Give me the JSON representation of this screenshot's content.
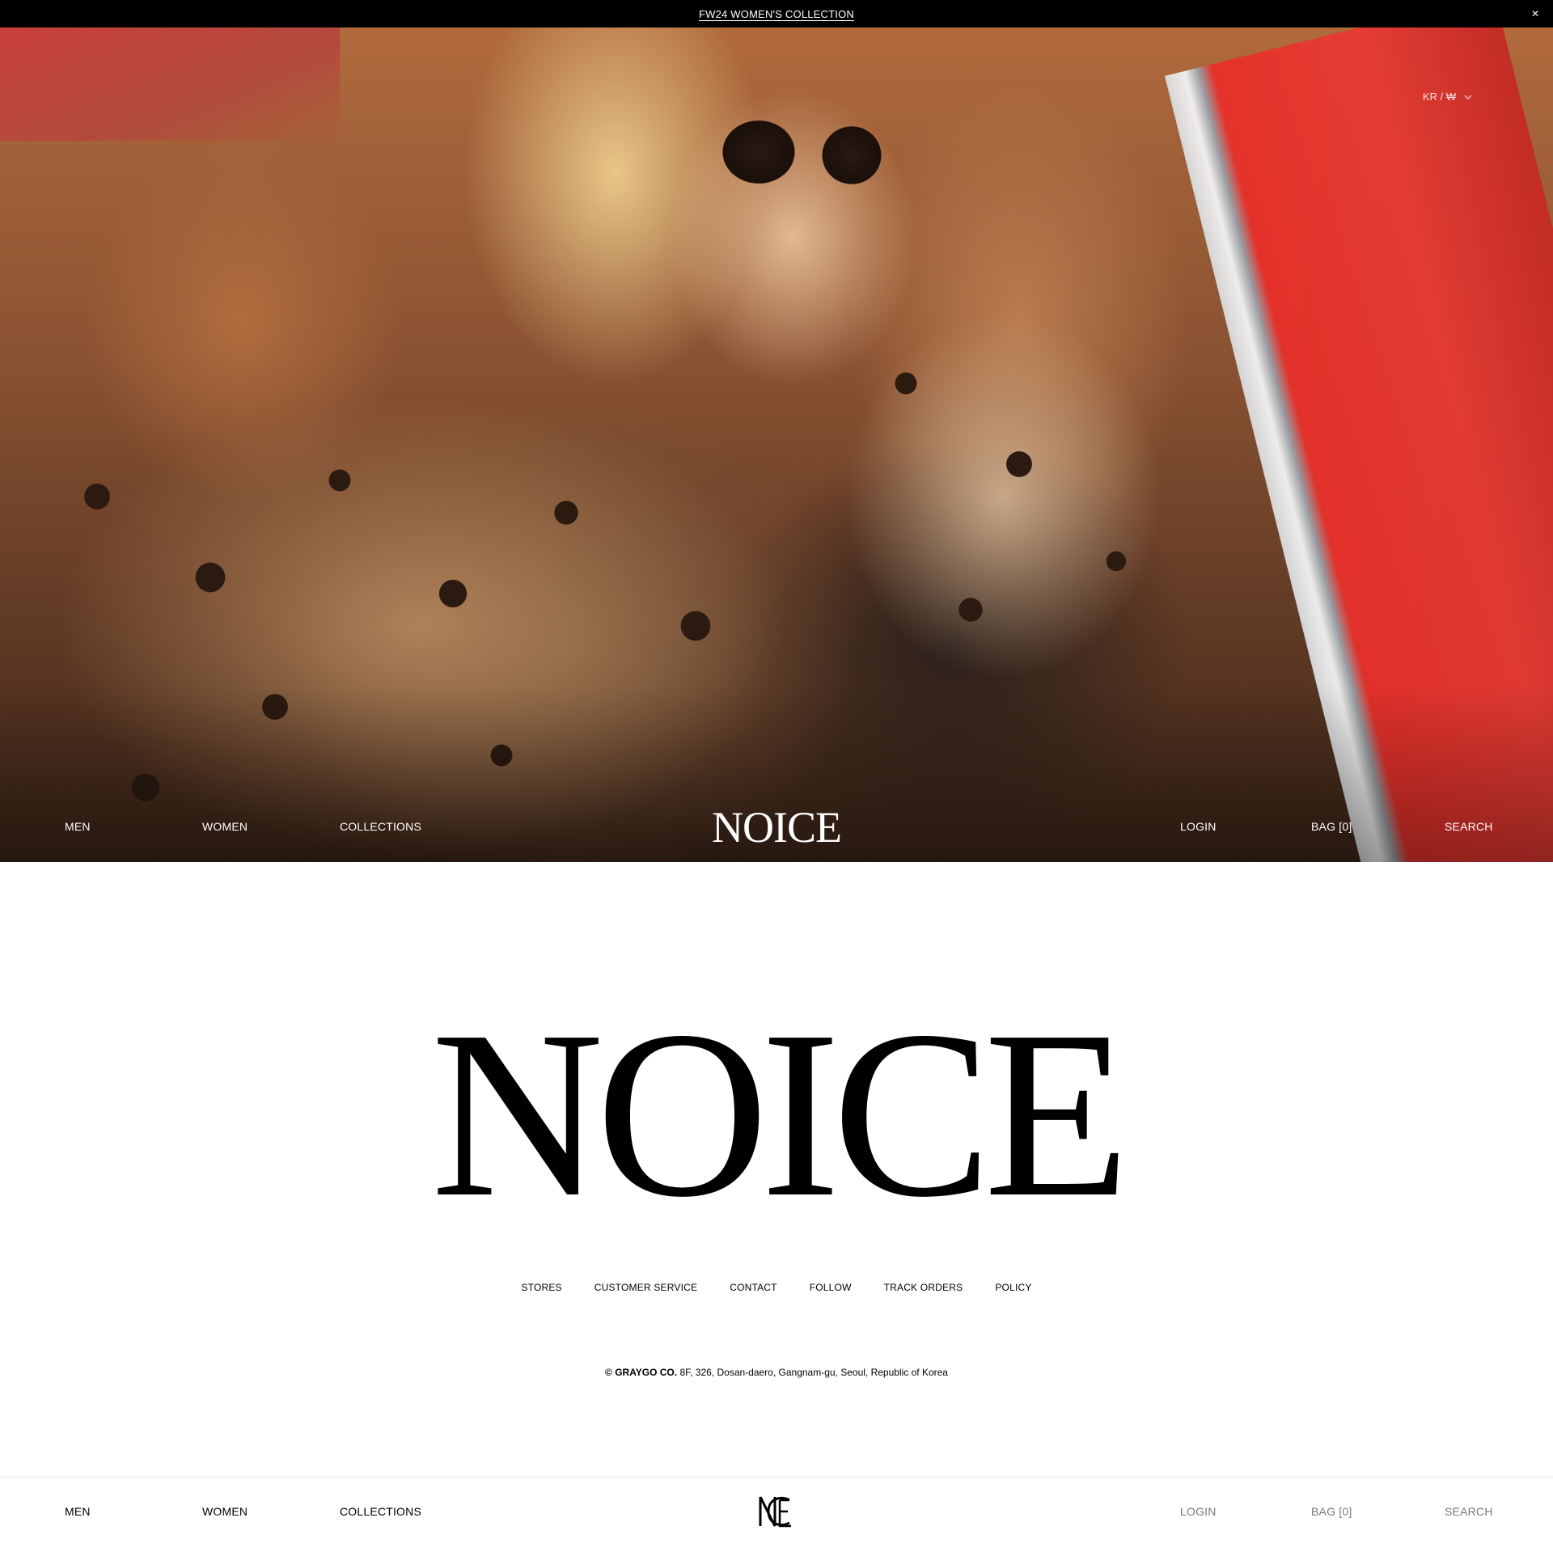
{
  "announcement": {
    "text": "FW24 WOMEN'S COLLECTION",
    "close_icon": "close-icon"
  },
  "locale": {
    "label": "KR / ₩",
    "icon": "chevron-down-icon"
  },
  "hero_nav": {
    "men": "MEN",
    "women": "WOMEN",
    "collections": "COLLECTIONS",
    "logo": "NOICE",
    "login": "LOGIN",
    "bag": "BAG [0]",
    "search": "SEARCH"
  },
  "wordmark": "NOICE",
  "footer": {
    "links": [
      "STORES",
      "CUSTOMER SERVICE",
      "CONTACT",
      "FOLLOW",
      "TRACK ORDERS",
      "POLICY"
    ],
    "copyright_bold": "© GRAYGO CO.",
    "copyright_rest": " 8F, 326, Dosan-daero, Gangnam-gu, Seoul, Republic of Korea"
  },
  "bottom_nav": {
    "men": "MEN",
    "women": "WOMEN",
    "collections": "COLLECTIONS",
    "logo_icon": "noice-monogram-icon",
    "login": "LOGIN",
    "bag": "BAG [0]",
    "search": "SEARCH"
  },
  "colors": {
    "announcement_bg": "#000000",
    "page_bg": "#ffffff",
    "text": "#000000",
    "dim_text": "#777777"
  }
}
